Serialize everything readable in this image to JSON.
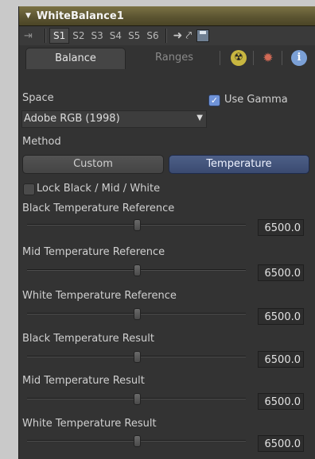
{
  "header": {
    "title": "WhiteBalance1"
  },
  "toolbar": {
    "slots": [
      "S1",
      "S2",
      "S3",
      "S4",
      "S5",
      "S6"
    ],
    "active_slot": "S1"
  },
  "tabs": [
    {
      "label": "Balance",
      "active": true
    },
    {
      "label": "Ranges",
      "active": false
    }
  ],
  "icons": {
    "pin": "pin-icon",
    "radioactive": "radioactive-icon",
    "gear": "gear-icon",
    "info": "info-icon"
  },
  "space": {
    "label": "Space",
    "value": "Adobe RGB (1998)"
  },
  "use_gamma": {
    "label": "Use Gamma",
    "checked": true
  },
  "method": {
    "label": "Method",
    "options": [
      "Custom",
      "Temperature"
    ],
    "selected": "Temperature"
  },
  "lock": {
    "label": "Lock Black / Mid / White",
    "checked": false
  },
  "sliders": [
    {
      "label": "Black Temperature Reference",
      "value": "6500.0"
    },
    {
      "label": "Mid Temperature Reference",
      "value": "6500.0"
    },
    {
      "label": "White Temperature Reference",
      "value": "6500.0"
    },
    {
      "label": "Black Temperature Result",
      "value": "6500.0"
    },
    {
      "label": "Mid Temperature Result",
      "value": "6500.0"
    },
    {
      "label": "White Temperature Result",
      "value": "6500.0"
    }
  ],
  "colors": {
    "header": "#5a5330",
    "accent": "#3a4a70",
    "panel": "#333333"
  }
}
